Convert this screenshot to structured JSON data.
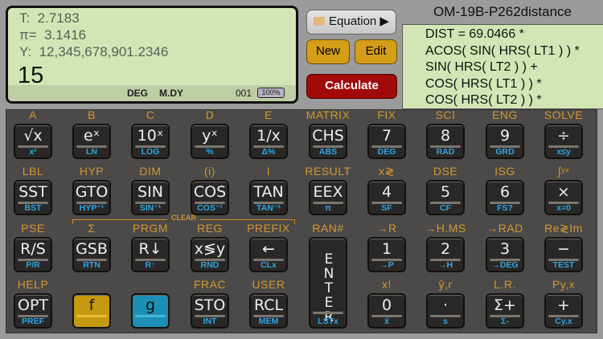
{
  "display": {
    "lines": [
      "T:  2.7183",
      "π=  3.1416",
      "Y:  12,345,678,901.2346"
    ],
    "entry": "15_",
    "angle": "DEG",
    "date_mode": "M.DY",
    "program_step": "001",
    "battery": "100%"
  },
  "equation_panel": {
    "equation_button": "Equation ▶",
    "new_button": "New",
    "edit_button": "Edit",
    "calculate_button": "Calculate",
    "title": "OM-19B-P262distance",
    "lines": [
      "DIST = 69.0466 *",
      "ACOS( SIN( HRS( LT1 ) ) *",
      "SIN( HRS( LT2 ) ) +",
      "COS( HRS( LT1 ) ) *",
      "COS( HRS( LT2 ) ) *"
    ]
  },
  "clear_label": "CLEAR",
  "keys": [
    [
      {
        "gold": "A",
        "main": "√x",
        "blue": "x²"
      },
      {
        "gold": "B",
        "main": "eˣ",
        "blue": "LN"
      },
      {
        "gold": "C",
        "main": "10ˣ",
        "blue": "LOG"
      },
      {
        "gold": "D",
        "main": "yˣ",
        "blue": "%"
      },
      {
        "gold": "E",
        "main": "1/x",
        "blue": "Δ%"
      },
      {
        "gold": "MATRIX",
        "main": "CHS",
        "blue": "ABS"
      },
      {
        "gold": "FIX",
        "main": "7",
        "blue": "DEG"
      },
      {
        "gold": "SCI",
        "main": "8",
        "blue": "RAD"
      },
      {
        "gold": "ENG",
        "main": "9",
        "blue": "GRD"
      },
      {
        "gold": "SOLVE",
        "main": "÷",
        "blue": "x≤y"
      }
    ],
    [
      {
        "gold": "LBL",
        "main": "SST",
        "blue": "BST"
      },
      {
        "gold": "HYP",
        "main": "GTO",
        "blue": "HYP⁻¹"
      },
      {
        "gold": "DIM",
        "main": "SIN",
        "blue": "SIN⁻¹"
      },
      {
        "gold": "(i)",
        "main": "COS",
        "blue": "COS⁻¹"
      },
      {
        "gold": "I",
        "main": "TAN",
        "blue": "TAN⁻¹"
      },
      {
        "gold": "RESULT",
        "main": "EEX",
        "blue": "π"
      },
      {
        "gold": "x≷",
        "main": "4",
        "blue": "SF"
      },
      {
        "gold": "DSE",
        "main": "5",
        "blue": "CF"
      },
      {
        "gold": "ISG",
        "main": "6",
        "blue": "FS?"
      },
      {
        "gold": "∫ʸˣ",
        "main": "×",
        "blue": "x=0"
      }
    ],
    [
      {
        "gold": "PSE",
        "main": "R/S",
        "blue": "P/R"
      },
      {
        "gold": "Σ",
        "main": "GSB",
        "blue": "RTN"
      },
      {
        "gold": "PRGM",
        "main": "R↓",
        "blue": "R↑"
      },
      {
        "gold": "REG",
        "main": "x≶y",
        "blue": "RND"
      },
      {
        "gold": "PREFIX",
        "main": "←",
        "blue": "CLx"
      },
      {
        "gold": "RAN#",
        "main": "ENTER",
        "blue": "LSTx"
      },
      {
        "gold": "→R",
        "main": "1",
        "blue": "→P"
      },
      {
        "gold": "→H.MS",
        "main": "2",
        "blue": "→H"
      },
      {
        "gold": "→RAD",
        "main": "3",
        "blue": "→DEG"
      },
      {
        "gold": "Re≷Im",
        "main": "−",
        "blue": "TEST"
      }
    ],
    [
      {
        "gold": "HELP",
        "main": "OPT",
        "blue": "PREF"
      },
      {
        "gold": "",
        "main": "f",
        "blue": ""
      },
      {
        "gold": "",
        "main": "g",
        "blue": ""
      },
      {
        "gold": "FRAC",
        "main": "STO",
        "blue": "INT"
      },
      {
        "gold": "USER",
        "main": "RCL",
        "blue": "MEM"
      },
      null,
      {
        "gold": "x!",
        "main": "0",
        "blue": "x̄"
      },
      {
        "gold": "ŷ,r",
        "main": "·",
        "blue": "s"
      },
      {
        "gold": "L.R.",
        "main": "Σ+",
        "blue": "Σ-"
      },
      {
        "gold": "Py,x",
        "main": "+",
        "blue": "Cy,x"
      }
    ]
  ]
}
